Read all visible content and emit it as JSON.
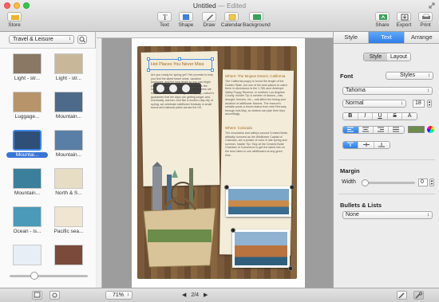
{
  "window": {
    "title": "Untitled",
    "status": "— Edited"
  },
  "toolbar": {
    "store": "Store",
    "text": "Text",
    "shape": "Shape",
    "draw": "Draw",
    "calendar": "Calendar",
    "background": "Background",
    "share": "Share",
    "export": "Export",
    "print": "Print"
  },
  "sidebar": {
    "category": "Travel & Leisure",
    "thumbnails": [
      {
        "label": "Light - str...",
        "color": "#8a7864"
      },
      {
        "label": "Light - str...",
        "color": "#c9b79a"
      },
      {
        "label": "Luggage...",
        "color": "#b8946a"
      },
      {
        "label": "Mountain...",
        "color": "#4d6a8a"
      },
      {
        "label": "Mountai...",
        "color": "#2f4f78",
        "selected": true
      },
      {
        "label": "Mountain...",
        "color": "#5a7fa6"
      },
      {
        "label": "Mountain...",
        "color": "#3b7f9a"
      },
      {
        "label": "North & S...",
        "color": "#e7dcc4"
      },
      {
        "label": "Ocean - is...",
        "color": "#4a9ab8"
      },
      {
        "label": "Pacific sea...",
        "color": "#efe5d0"
      },
      {
        "label": "",
        "color": "#e8eef5"
      },
      {
        "label": "",
        "color": "#7a4a3a"
      }
    ]
  },
  "document": {
    "heading_left": "Hot Places You Never Miss",
    "body_left": "Are you ready for spring yet? We promise to help you find the latest travel news, vacation packages, and the best deals so you can begin planning your next trip. In deserts across the southwest and alpine meadows, wildflowers are the color-saturated harbingers of spring—nature's guarantee that the days are getting longer and, eventually, warmer. And like a modern-day city of spring, we celebrate wildflower festivals in small towns and national parks across the US.",
    "heading_right": "Where: The Mojave Desert, California",
    "body_right": "The California poppy is found the length of the Golden State, but one of the best places to catch them in abundance is the 1,780-acre Antelope Valley Poppy Reserve, in northern Los Angeles County. Insider Tip: A number of factors—rain, drought, freezes, etc.—will affect the timing and duration of wildflower blooms. The reserve's website posts a bloom status from mid-February through mid-May, so visitors can plan their trips accordingly.",
    "heading_right2": "Where: Colorado",
    "body_right2": "The mountains and valleys around Crested Butte, officially honored as the Wildflower Capital of Colorado, are a jumble of color in late spring and summer. Insider Tip: Stop at the Crested Butte Chamber of Commerce to get the latest info on the best hikes to see wildflowers at any given time."
  },
  "bottombar": {
    "zoom": "71%",
    "page": "2/4"
  },
  "inspector": {
    "tabs": [
      "Style",
      "Text",
      "Arrange"
    ],
    "active_tab": "Text",
    "sub_tabs": [
      "Style",
      "Layout"
    ],
    "active_sub_tab": "Style",
    "font_label": "Font",
    "styles_button": "Styles",
    "font_family": "Tahoma",
    "font_weight": "Normal",
    "font_size": "18",
    "format_buttons": [
      "B",
      "I",
      "U",
      "S",
      "A"
    ],
    "text_color": "#6b8c4a",
    "margin_label": "Margin",
    "width_label": "Width",
    "width_value": "0",
    "bullets_label": "Bullets & Lists",
    "bullets_value": "None"
  }
}
